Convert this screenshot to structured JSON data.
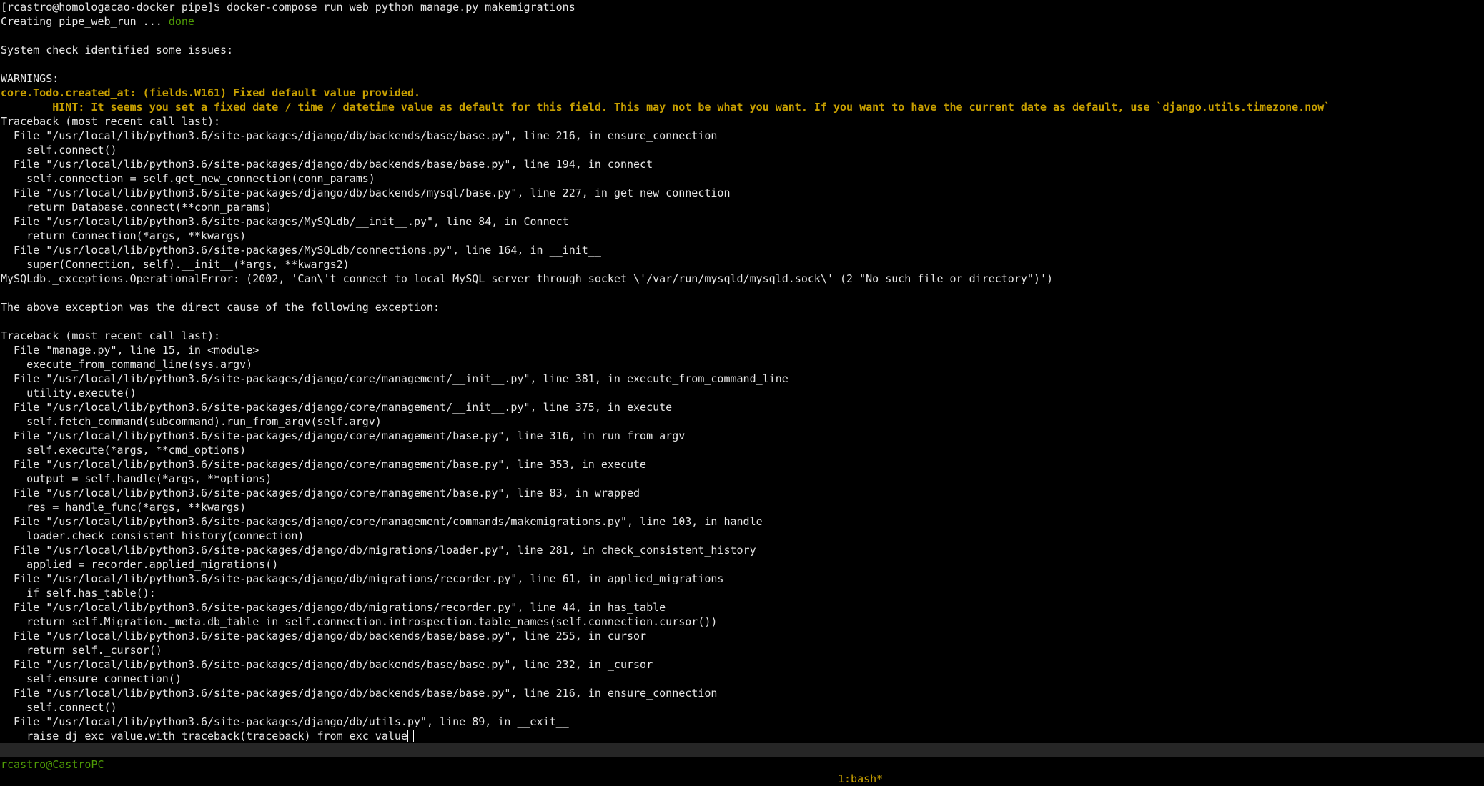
{
  "colors": {
    "warning": "#c8a000",
    "success": "#4e9a06",
    "status_bar_bg": "#262626",
    "background": "#000000",
    "text": "#e6e6e6"
  },
  "terminal": {
    "prompt": "[rcastro@homologacao-docker pipe]$ ",
    "command": "docker-compose run web python manage.py makemigrations",
    "creating": "Creating pipe_web_run ... ",
    "creating_status": "done",
    "lines": [
      {
        "text": "",
        "style": "normal"
      },
      {
        "text": "System check identified some issues:",
        "style": "normal"
      },
      {
        "text": "",
        "style": "normal"
      },
      {
        "text": "WARNINGS:",
        "style": "normal"
      },
      {
        "text": "core.Todo.created_at: (fields.W161) Fixed default value provided.",
        "style": "warn"
      },
      {
        "text": "        HINT: It seems you set a fixed date / time / datetime value as default for this field. This may not be what you want. If you want to have the current date as default, use `django.utils.timezone.now`",
        "style": "warn"
      },
      {
        "text": "Traceback (most recent call last):",
        "style": "normal"
      },
      {
        "text": "  File \"/usr/local/lib/python3.6/site-packages/django/db/backends/base/base.py\", line 216, in ensure_connection",
        "style": "normal"
      },
      {
        "text": "    self.connect()",
        "style": "normal"
      },
      {
        "text": "  File \"/usr/local/lib/python3.6/site-packages/django/db/backends/base/base.py\", line 194, in connect",
        "style": "normal"
      },
      {
        "text": "    self.connection = self.get_new_connection(conn_params)",
        "style": "normal"
      },
      {
        "text": "  File \"/usr/local/lib/python3.6/site-packages/django/db/backends/mysql/base.py\", line 227, in get_new_connection",
        "style": "normal"
      },
      {
        "text": "    return Database.connect(**conn_params)",
        "style": "normal"
      },
      {
        "text": "  File \"/usr/local/lib/python3.6/site-packages/MySQLdb/__init__.py\", line 84, in Connect",
        "style": "normal"
      },
      {
        "text": "    return Connection(*args, **kwargs)",
        "style": "normal"
      },
      {
        "text": "  File \"/usr/local/lib/python3.6/site-packages/MySQLdb/connections.py\", line 164, in __init__",
        "style": "normal"
      },
      {
        "text": "    super(Connection, self).__init__(*args, **kwargs2)",
        "style": "normal"
      },
      {
        "text": "MySQLdb._exceptions.OperationalError: (2002, 'Can\\'t connect to local MySQL server through socket \\'/var/run/mysqld/mysqld.sock\\' (2 \"No such file or directory\")')",
        "style": "normal"
      },
      {
        "text": "",
        "style": "normal"
      },
      {
        "text": "The above exception was the direct cause of the following exception:",
        "style": "normal"
      },
      {
        "text": "",
        "style": "normal"
      },
      {
        "text": "Traceback (most recent call last):",
        "style": "normal"
      },
      {
        "text": "  File \"manage.py\", line 15, in <module>",
        "style": "normal"
      },
      {
        "text": "    execute_from_command_line(sys.argv)",
        "style": "normal"
      },
      {
        "text": "  File \"/usr/local/lib/python3.6/site-packages/django/core/management/__init__.py\", line 381, in execute_from_command_line",
        "style": "normal"
      },
      {
        "text": "    utility.execute()",
        "style": "normal"
      },
      {
        "text": "  File \"/usr/local/lib/python3.6/site-packages/django/core/management/__init__.py\", line 375, in execute",
        "style": "normal"
      },
      {
        "text": "    self.fetch_command(subcommand).run_from_argv(self.argv)",
        "style": "normal"
      },
      {
        "text": "  File \"/usr/local/lib/python3.6/site-packages/django/core/management/base.py\", line 316, in run_from_argv",
        "style": "normal"
      },
      {
        "text": "    self.execute(*args, **cmd_options)",
        "style": "normal"
      },
      {
        "text": "  File \"/usr/local/lib/python3.6/site-packages/django/core/management/base.py\", line 353, in execute",
        "style": "normal"
      },
      {
        "text": "    output = self.handle(*args, **options)",
        "style": "normal"
      },
      {
        "text": "  File \"/usr/local/lib/python3.6/site-packages/django/core/management/base.py\", line 83, in wrapped",
        "style": "normal"
      },
      {
        "text": "    res = handle_func(*args, **kwargs)",
        "style": "normal"
      },
      {
        "text": "  File \"/usr/local/lib/python3.6/site-packages/django/core/management/commands/makemigrations.py\", line 103, in handle",
        "style": "normal"
      },
      {
        "text": "    loader.check_consistent_history(connection)",
        "style": "normal"
      },
      {
        "text": "  File \"/usr/local/lib/python3.6/site-packages/django/db/migrations/loader.py\", line 281, in check_consistent_history",
        "style": "normal"
      },
      {
        "text": "    applied = recorder.applied_migrations()",
        "style": "normal"
      },
      {
        "text": "  File \"/usr/local/lib/python3.6/site-packages/django/db/migrations/recorder.py\", line 61, in applied_migrations",
        "style": "normal"
      },
      {
        "text": "    if self.has_table():",
        "style": "normal"
      },
      {
        "text": "  File \"/usr/local/lib/python3.6/site-packages/django/db/migrations/recorder.py\", line 44, in has_table",
        "style": "normal"
      },
      {
        "text": "    return self.Migration._meta.db_table in self.connection.introspection.table_names(self.connection.cursor())",
        "style": "normal"
      },
      {
        "text": "  File \"/usr/local/lib/python3.6/site-packages/django/db/backends/base/base.py\", line 255, in cursor",
        "style": "normal"
      },
      {
        "text": "    return self._cursor()",
        "style": "normal"
      },
      {
        "text": "  File \"/usr/local/lib/python3.6/site-packages/django/db/backends/base/base.py\", line 232, in _cursor",
        "style": "normal"
      },
      {
        "text": "    self.ensure_connection()",
        "style": "normal"
      },
      {
        "text": "  File \"/usr/local/lib/python3.6/site-packages/django/db/backends/base/base.py\", line 216, in ensure_connection",
        "style": "normal"
      },
      {
        "text": "    self.connect()",
        "style": "normal"
      },
      {
        "text": "  File \"/usr/local/lib/python3.6/site-packages/django/db/utils.py\", line 89, in __exit__",
        "style": "normal"
      }
    ],
    "last_line": "    raise dj_exc_value.with_traceback(traceback) from exc_value"
  },
  "status_bar": {
    "session": "rcastro@CastroPC",
    "window": "1:bash*"
  }
}
